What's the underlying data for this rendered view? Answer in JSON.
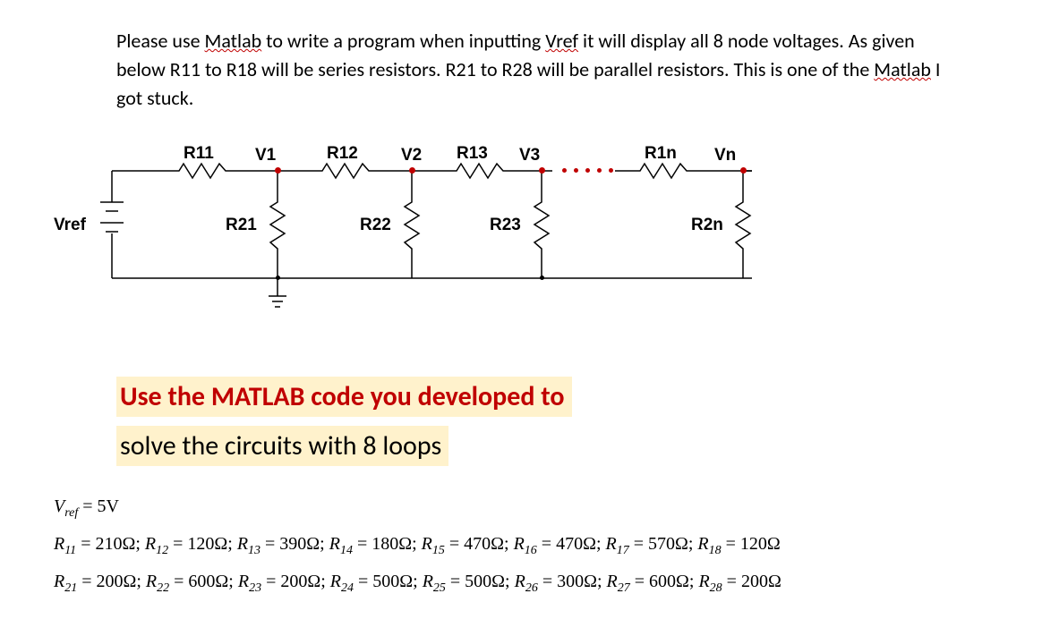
{
  "intro": {
    "part1": "Please use ",
    "matlab1": "Matlab",
    "part2": " to write a program when inputting ",
    "vref1": "Vref",
    "part3": " it will display all 8 node voltages. As given below R11 to R18 will be series resistors. R21 to R28 will be parallel resistors. This is one of the ",
    "matlab2": "Matlab",
    "part4": " I got stuck."
  },
  "circuit": {
    "vref": "Vref",
    "r11": "R11",
    "r12": "R12",
    "r13": "R13",
    "r1n": "R1n",
    "r21": "R21",
    "r22": "R22",
    "r23": "R23",
    "r2n": "R2n",
    "v1": "V1",
    "v2": "V2",
    "v3": "V3",
    "vn": "Vn"
  },
  "task": {
    "line1": "Use the MATLAB code you developed to",
    "line2": "solve the circuits with 8 loops"
  },
  "params": {
    "vref_label": "V",
    "vref_sub": "ref",
    "vref_eq": " = 5V",
    "r1_line": {
      "items": [
        {
          "label": "R",
          "sub": "11",
          "val": " = 210Ω; "
        },
        {
          "label": "R",
          "sub": "12",
          "val": " = 120Ω; "
        },
        {
          "label": "R",
          "sub": "13",
          "val": " = 390Ω; "
        },
        {
          "label": "R",
          "sub": "14",
          "val": " = 180Ω; "
        },
        {
          "label": "R",
          "sub": "15",
          "val": " = 470Ω; "
        },
        {
          "label": "R",
          "sub": "16",
          "val": " = 470Ω; "
        },
        {
          "label": "R",
          "sub": "17",
          "val": " = 570Ω; "
        },
        {
          "label": "R",
          "sub": "18",
          "val": " = 120Ω"
        }
      ]
    },
    "r2_line": {
      "items": [
        {
          "label": "R",
          "sub": "21",
          "val": " = 200Ω; "
        },
        {
          "label": "R",
          "sub": "22",
          "val": " = 600Ω; "
        },
        {
          "label": "R",
          "sub": "23",
          "val": " = 200Ω; "
        },
        {
          "label": "R",
          "sub": "24",
          "val": " = 500Ω; "
        },
        {
          "label": "R",
          "sub": "25",
          "val": " = 500Ω; "
        },
        {
          "label": "R",
          "sub": "26",
          "val": " = 300Ω; "
        },
        {
          "label": "R",
          "sub": "27",
          "val": " = 600Ω; "
        },
        {
          "label": "R",
          "sub": "28",
          "val": " = 200Ω"
        }
      ]
    }
  }
}
